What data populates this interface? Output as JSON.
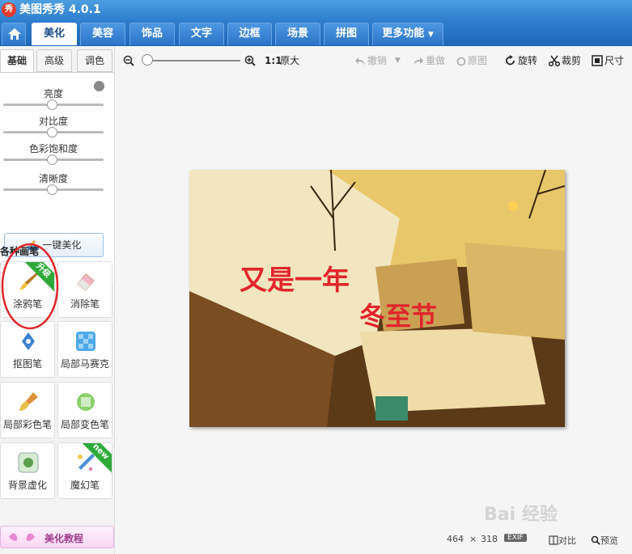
{
  "app": {
    "title": "美图秀秀 4.0.1",
    "logo_text": "秀"
  },
  "nav": {
    "home_icon": "home-icon",
    "tabs": [
      {
        "label": "美化",
        "active": true
      },
      {
        "label": "美容"
      },
      {
        "label": "饰品"
      },
      {
        "label": "文字"
      },
      {
        "label": "边框"
      },
      {
        "label": "场景"
      },
      {
        "label": "拼图"
      },
      {
        "label": "更多功能"
      }
    ]
  },
  "toolbar": {
    "zoom_ratio": "1:1",
    "original_size": "原大",
    "undo": "撤销",
    "redo": "重做",
    "original": "原图",
    "rotate": "旋转",
    "crop": "裁剪",
    "resize": "尺寸"
  },
  "sidebar": {
    "subtabs": [
      "基础",
      "高级",
      "调色"
    ],
    "adjustments": [
      {
        "label": "亮度",
        "level": 0.5
      },
      {
        "label": "对比度",
        "level": 0.5
      },
      {
        "label": "色彩饱和度",
        "level": 0.5
      },
      {
        "label": "清晰度",
        "level": 0.5
      }
    ],
    "one_click": "一键美化",
    "brush_title": "各种画笔",
    "tools": [
      {
        "label": "涂鸦笔",
        "badge": "升级"
      },
      {
        "label": "消除笔"
      },
      {
        "label": "抠图笔"
      },
      {
        "label": "局部马赛克"
      },
      {
        "label": "局部彩色笔"
      },
      {
        "label": "局部变色笔"
      },
      {
        "label": "背景虚化"
      },
      {
        "label": "魔幻笔",
        "badge": "new"
      }
    ],
    "tutorial": "美化教程"
  },
  "photo": {
    "line1": "又是一年",
    "line2": "冬至节"
  },
  "status": {
    "width": "464",
    "times": "×",
    "height": "318",
    "exif": "EXIF",
    "compare": "对比",
    "preview": "预览"
  },
  "watermark": "Bai 经验",
  "colors": {
    "accent": "#2f7fcf",
    "annotation": "#e0262b",
    "upgrade_badge": "#2eaa3a"
  }
}
